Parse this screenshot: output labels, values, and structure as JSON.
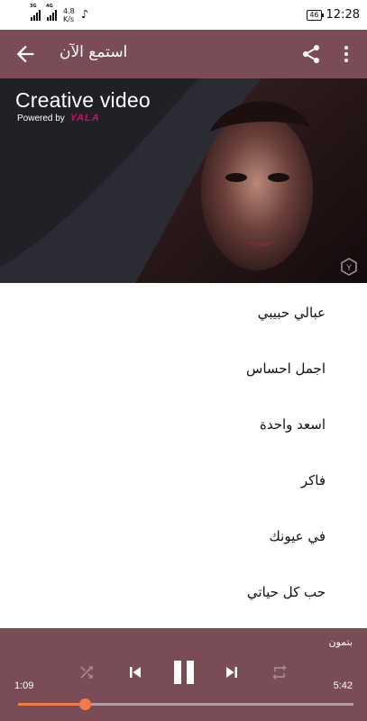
{
  "status_bar": {
    "net1": "3G",
    "net2": "4G",
    "speed_value": "4.8",
    "speed_unit": "K/s",
    "battery": "46",
    "time": "12:28"
  },
  "app_bar": {
    "title": "استمع الآن",
    "back_icon": "arrow-left-icon",
    "share_icon": "share-icon",
    "more_icon": "more-vert-icon"
  },
  "banner": {
    "title": "Creative video",
    "powered_by": "Powered by",
    "brand": "YALA",
    "badge": "Y"
  },
  "songs": [
    {
      "title": "عبالي حبيبي"
    },
    {
      "title": "اجمل احساس"
    },
    {
      "title": "اسعد واحدة"
    },
    {
      "title": "فاكر"
    },
    {
      "title": "في عيونك"
    },
    {
      "title": "حب كل حياتي"
    }
  ],
  "player": {
    "now_playing": "بتمون",
    "elapsed": "1:09",
    "total": "5:42",
    "progress": 0.2,
    "colors": {
      "bar": "#7a4c55",
      "accent": "#ef7b45"
    },
    "controls": [
      "shuffle-icon",
      "previous-icon",
      "pause-icon",
      "next-icon",
      "repeat-icon"
    ]
  }
}
